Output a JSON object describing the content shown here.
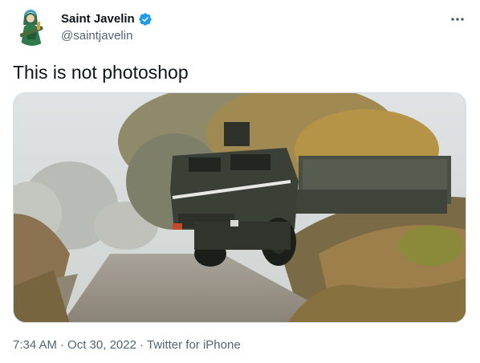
{
  "author": {
    "display_name": "Saint Javelin",
    "handle": "@saintjavelin",
    "verified": true,
    "avatar_icon": "saint-javelin-avatar"
  },
  "tweet": {
    "text": "This is not photoshop",
    "media_description_icon": "himars-photo"
  },
  "meta": {
    "time": "7:34 AM",
    "separator1": "·",
    "date": "Oct 30, 2022",
    "separator2": "·",
    "source": "Twitter for iPhone"
  },
  "colors": {
    "text_primary": "#0f1419",
    "text_secondary": "#536471",
    "verified_blue": "#1d9bf0",
    "border": "#cfd9de"
  }
}
